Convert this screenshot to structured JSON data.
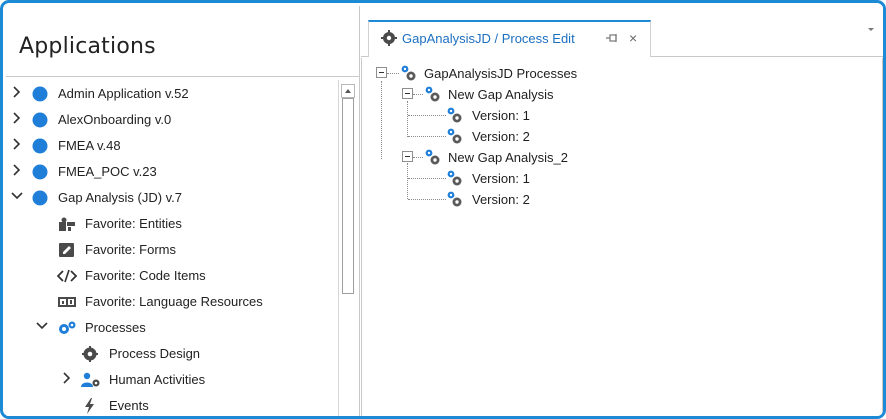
{
  "left_panel": {
    "title": "Applications",
    "items": [
      {
        "label": "Admin Application v.52",
        "expanded": false
      },
      {
        "label": "AlexOnboarding v.0",
        "expanded": false
      },
      {
        "label": "FMEA v.48",
        "expanded": false
      },
      {
        "label": "FMEA_POC v.23",
        "expanded": false
      },
      {
        "label": "Gap Analysis (JD) v.7",
        "expanded": true
      },
      {
        "label": "Favorite: Entities",
        "icon": "entities-puzzle-icon"
      },
      {
        "label": "Favorite: Forms",
        "icon": "forms-pencil-icon"
      },
      {
        "label": "Favorite: Code Items",
        "icon": "code-brackets-icon"
      },
      {
        "label": "Favorite: Language Resources",
        "icon": "language-resource-icon"
      },
      {
        "label": "Processes",
        "icon": "processes-gears-icon",
        "expanded": true
      },
      {
        "label": "Process Design",
        "icon": "gear-icon"
      },
      {
        "label": "Human Activities",
        "icon": "user-gear-icon",
        "expanded": false
      },
      {
        "label": "Events",
        "icon": "lightning-icon"
      }
    ]
  },
  "tab": {
    "label": "GapAnalysisJD / Process Edit",
    "icon": "gear-icon",
    "pin_icon": "pin-icon",
    "close_label": "×"
  },
  "process_tree": {
    "root": "GapAnalysisJD Processes",
    "processes": [
      {
        "label": "New Gap Analysis",
        "versions": [
          "Version: 1",
          "Version: 2"
        ]
      },
      {
        "label": "New Gap Analysis_2",
        "versions": [
          "Version: 1",
          "Version: 2"
        ]
      }
    ]
  },
  "colors": {
    "accent": "#1d8ad6",
    "app_dot": "#1f7fd8",
    "tab_text": "#1d6fbf",
    "icon_dark": "#4a4a4a"
  }
}
